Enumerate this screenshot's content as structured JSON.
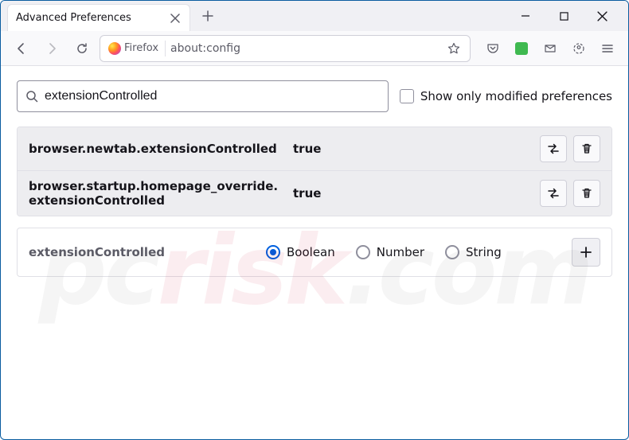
{
  "tab": {
    "title": "Advanced Preferences"
  },
  "url": {
    "identity": "Firefox",
    "address": "about:config"
  },
  "search": {
    "value": "extensionControlled",
    "modified_label": "Show only modified preferences"
  },
  "prefs": [
    {
      "name": "browser.newtab.extensionControlled",
      "value": "true"
    },
    {
      "name": "browser.startup.homepage_override.extensionControlled",
      "value": "true"
    }
  ],
  "new_pref": {
    "name": "extensionControlled",
    "types": [
      "Boolean",
      "Number",
      "String"
    ],
    "selected_type": "Boolean"
  },
  "watermark": {
    "a": "pc",
    "b": "risk",
    "c": ".com"
  }
}
